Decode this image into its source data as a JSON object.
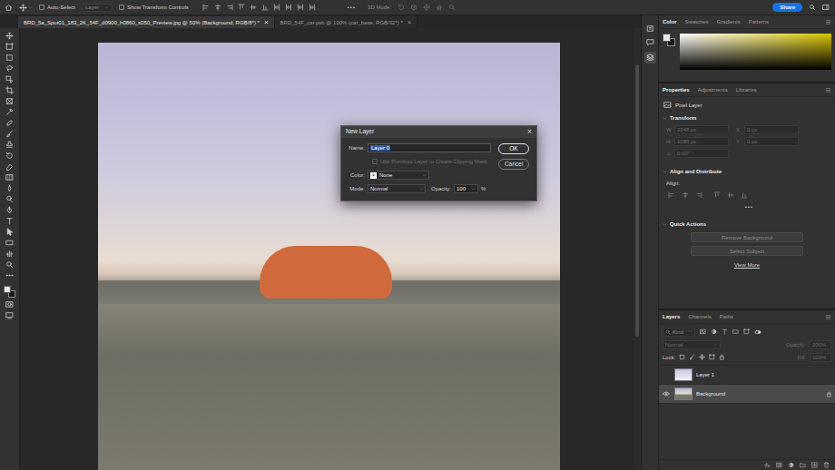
{
  "options_bar": {
    "auto_select": {
      "label": "Auto-Select",
      "checked": false
    },
    "target": "Layer",
    "show_transform": {
      "label": "Show Transform Controls",
      "checked": false
    },
    "more": "•••",
    "mode_3d": "3D Mode:",
    "share": "Share"
  },
  "documents": [
    {
      "label": "BRD_5a_Spot01_183_2K_54F_d0900_h0860_s050_Preview.jpg @ 50% (Background, RGB/8*) *",
      "close": "×",
      "selected": true
    },
    {
      "label": "BRD_54F_car.psb @ 100% (car_base, RGB/32*) *",
      "close": "×",
      "selected": false
    }
  ],
  "dialog": {
    "title": "New Layer",
    "close": "×",
    "name_label": "Name:",
    "name_value": "Layer 0",
    "name_selected": true,
    "clip": {
      "label": "Use Previous Layer to Create Clipping Mask",
      "checked": false,
      "disabled": true
    },
    "color_label": "Color:",
    "color_swatch": "×",
    "color_value": "None",
    "mode_label": "Mode:",
    "mode_value": "Normal",
    "opacity_label": "Opacity:",
    "opacity_value": "100",
    "opacity_unit": "%",
    "buttons": [
      {
        "label": "OK",
        "default": true
      },
      {
        "label": "Cancel",
        "default": false
      }
    ]
  },
  "color_panel": {
    "tabs": [
      {
        "label": "Color",
        "selected": true
      },
      {
        "label": "Swatches",
        "selected": false
      },
      {
        "label": "Gradients",
        "selected": false
      },
      {
        "label": "Patterns",
        "selected": false
      }
    ]
  },
  "properties": {
    "tabs": [
      {
        "label": "Properties",
        "selected": true
      },
      {
        "label": "Adjustments",
        "selected": false
      },
      {
        "label": "Libraries",
        "selected": false
      }
    ],
    "layer_kind": "Pixel Layer",
    "transform": {
      "title": "Transform",
      "expanded": true,
      "disabled": true,
      "fields": [
        {
          "label": "W",
          "value": "2048 px"
        },
        {
          "label": "X",
          "value": "0 px"
        },
        {
          "label": "H",
          "value": "1080 px"
        },
        {
          "label": "Y",
          "value": "0 px"
        }
      ],
      "angle": "0.00°"
    },
    "align": {
      "title": "Align and Distribute",
      "expanded": true,
      "label": "Align:",
      "more": "•••"
    },
    "quick_actions": {
      "title": "Quick Actions",
      "expanded": true,
      "buttons": [
        "Remove Background",
        "Select Subject"
      ],
      "link": "View More"
    }
  },
  "layers_panel": {
    "tabs": [
      {
        "label": "Layers",
        "selected": true
      },
      {
        "label": "Channels",
        "selected": false
      },
      {
        "label": "Paths",
        "selected": false
      }
    ],
    "filter": "Kind",
    "blend_mode": "Normal",
    "opacity_label": "Opacity:",
    "opacity": "100%",
    "lock_label": "Lock:",
    "fill_label": "Fill:",
    "fill": "100%",
    "controls_disabled": true,
    "layers": [
      {
        "name": "Layer 1",
        "visible": false,
        "selected": false,
        "locked": false
      },
      {
        "name": "Background",
        "visible": true,
        "selected": true,
        "locked": true
      }
    ]
  }
}
